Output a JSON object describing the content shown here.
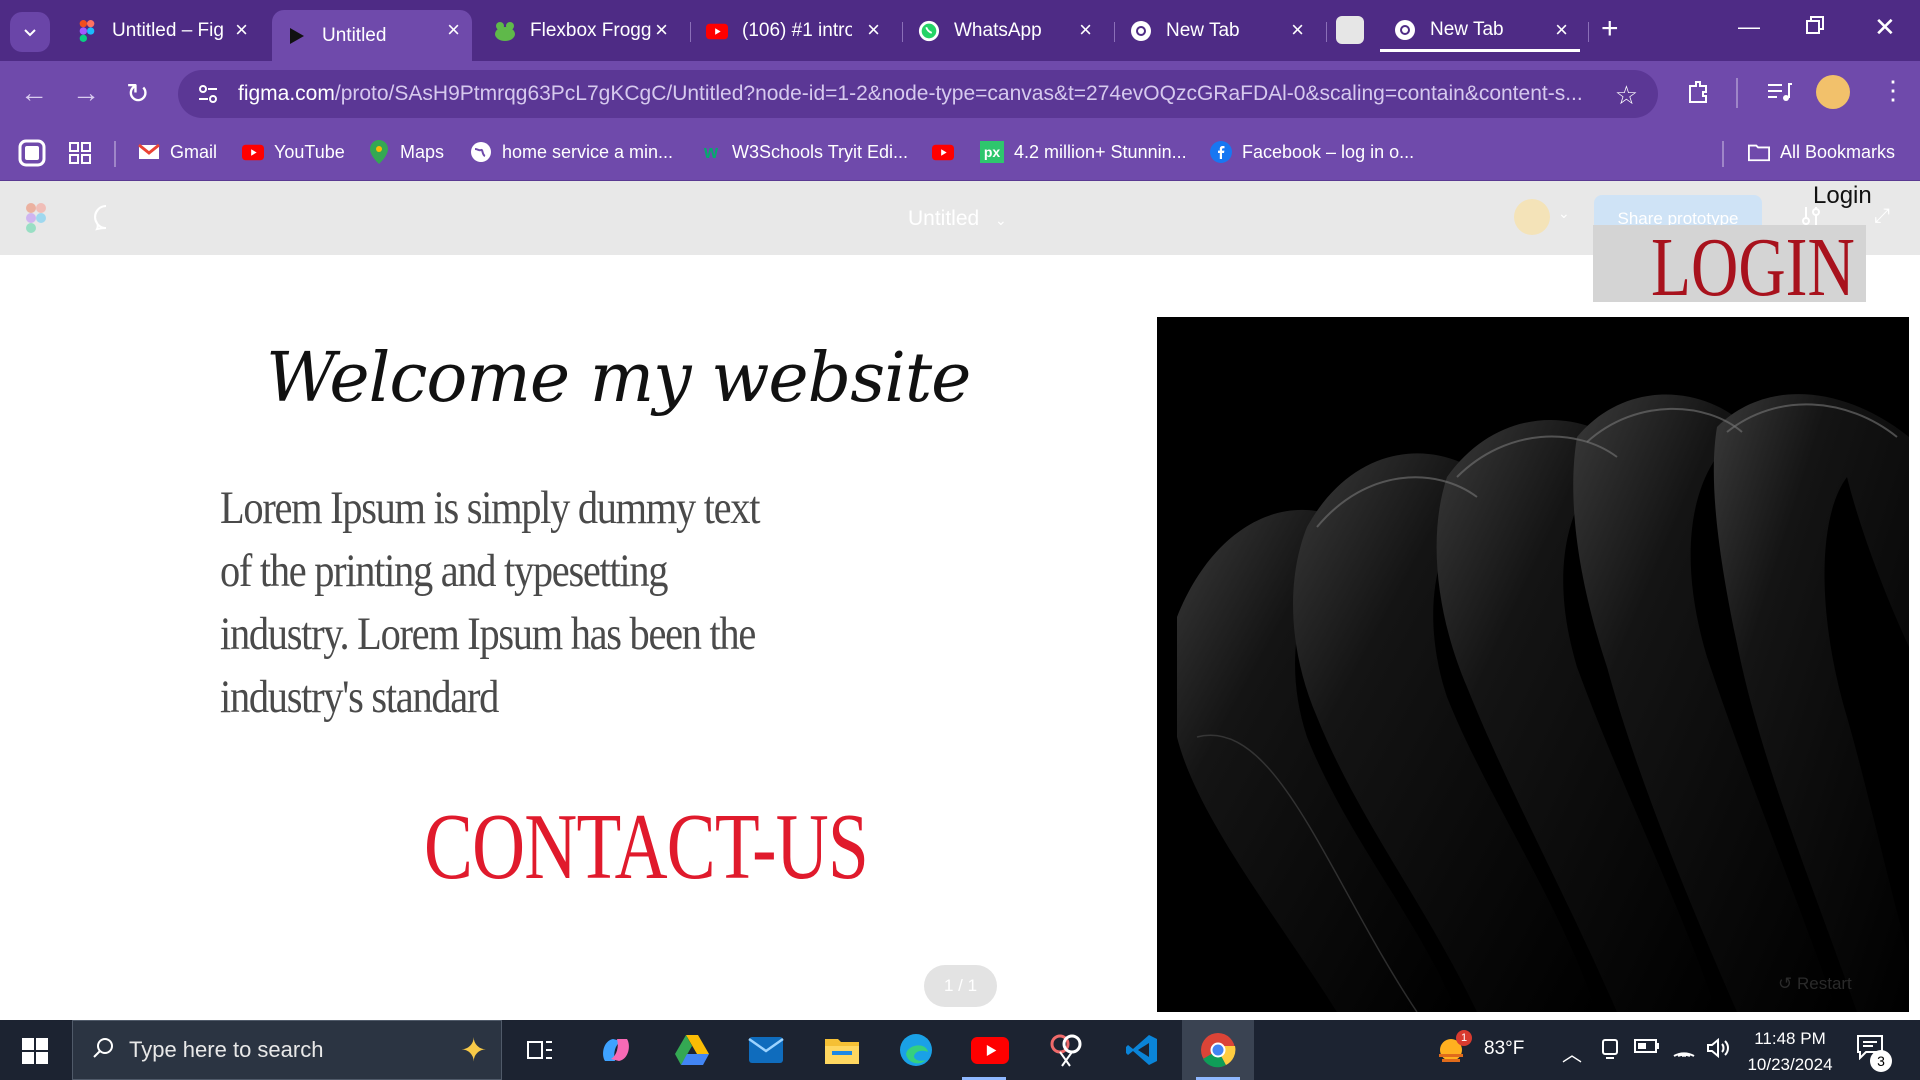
{
  "browser": {
    "tabs": [
      {
        "title": "Untitled – Fig",
        "icon": "figma-icon"
      },
      {
        "title": "Untitled",
        "icon": "play-icon",
        "active": true
      },
      {
        "title": "Flexbox Frogg",
        "icon": "frog-icon"
      },
      {
        "title": "(106) #1 intro",
        "icon": "youtube-icon"
      },
      {
        "title": "WhatsApp",
        "icon": "whatsapp-icon"
      },
      {
        "title": "New Tab",
        "icon": "chrome-icon"
      },
      {
        "title": "New Tab",
        "icon": "chrome-icon"
      }
    ],
    "url_host": "figma.com",
    "url_path": "/proto/SAsH9Ptmrqg63PcL7gKCgC/Untitled?node-id=1-2&node-type=canvas&t=274evOQzcGRaFDAl-0&scaling=contain&content-s...",
    "bookmarks": [
      {
        "label": "Gmail",
        "icon": "gmail-icon"
      },
      {
        "label": "YouTube",
        "icon": "youtube-icon"
      },
      {
        "label": "Maps",
        "icon": "maps-icon"
      },
      {
        "label": "home service a min...",
        "icon": "globe-icon"
      },
      {
        "label": "W3Schools Tryit Edi...",
        "icon": "w3schools-icon"
      },
      {
        "label": "",
        "icon": "youtube-icon"
      },
      {
        "label": "4.2 million+ Stunnin...",
        "icon": "pixabay-icon"
      },
      {
        "label": "Facebook – log in o...",
        "icon": "facebook-icon"
      }
    ],
    "all_bookmarks": "All Bookmarks"
  },
  "figma": {
    "file_title": "Untitled",
    "share_label": "Share prototype",
    "login_small": "Login",
    "page_indicator": "1 / 1",
    "restart_label": "Restart"
  },
  "page": {
    "welcome": "Welcome my website",
    "lorem": "Lorem Ipsum is simply dummy text of the printing and typesetting industry. Lorem Ipsum has been the industry's standard",
    "contact": "CONTACT-US",
    "login_big": "LOGIN"
  },
  "taskbar": {
    "search_placeholder": "Type here to search",
    "weather": "83°F",
    "time": "11:48 PM",
    "date": "10/23/2024",
    "notification_count": "3",
    "weather_badge": "1"
  },
  "colors": {
    "tab_strip": "#4e2b85",
    "toolbar": "#6f4aab",
    "contact_red": "#e01a2c",
    "login_red": "#a8121d"
  }
}
